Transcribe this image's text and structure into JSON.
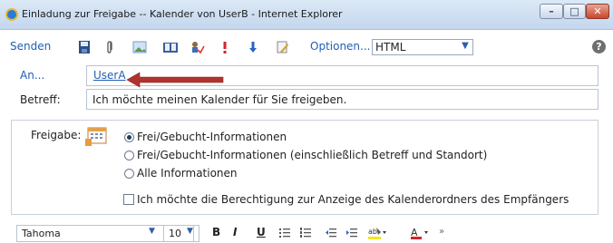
{
  "window": {
    "title": "Einladung zur Freigabe -- Kalender von UserB - Internet Explorer",
    "minimize": "–",
    "maximize": "□",
    "close": "✕"
  },
  "toolbar": {
    "send_label": "Senden",
    "options_label": "Optionen...",
    "format_value": "HTML"
  },
  "fields": {
    "to_label": "An...",
    "to_value": "UserA",
    "subject_label": "Betreff:",
    "subject_value": "Ich möchte meinen Kalender für Sie freigeben."
  },
  "sharing": {
    "label": "Freigabe:",
    "options": [
      {
        "label": "Frei/Gebucht-Informationen",
        "selected": true
      },
      {
        "label": "Frei/Gebucht-Informationen (einschließlich Betreff und Standort)",
        "selected": false
      },
      {
        "label": "Alle Informationen",
        "selected": false
      }
    ],
    "request_checkbox_label": "Ich möchte die Berechtigung zur Anzeige des Kalenderordners des Empfängers",
    "request_checked": false
  },
  "format_bar": {
    "font": "Tahoma",
    "size": "10",
    "bold": "B",
    "italic": "I",
    "underline": "U"
  },
  "colors": {
    "link_blue": "#1f5fb5",
    "annotation_arrow": "#b0332e"
  }
}
